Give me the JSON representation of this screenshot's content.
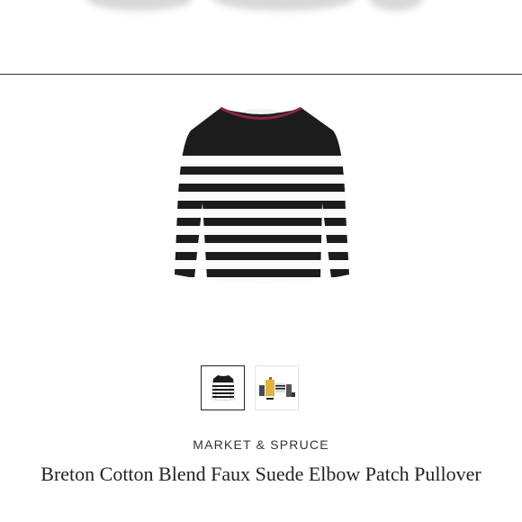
{
  "product": {
    "brand": "MARKET & SPRUCE",
    "title": "Breton Cotton Blend Faux Suede Elbow Patch Pullover"
  },
  "gallery": {
    "selected_index": 0,
    "thumbnails": [
      "striped-pullover-thumbnail",
      "outfit-flatlay-thumbnail"
    ]
  },
  "colors": {
    "divider": "#333333",
    "stripe_dark": "#1c1c1c",
    "stripe_light": "#fafafa",
    "collar_accent": "#8b2346"
  }
}
